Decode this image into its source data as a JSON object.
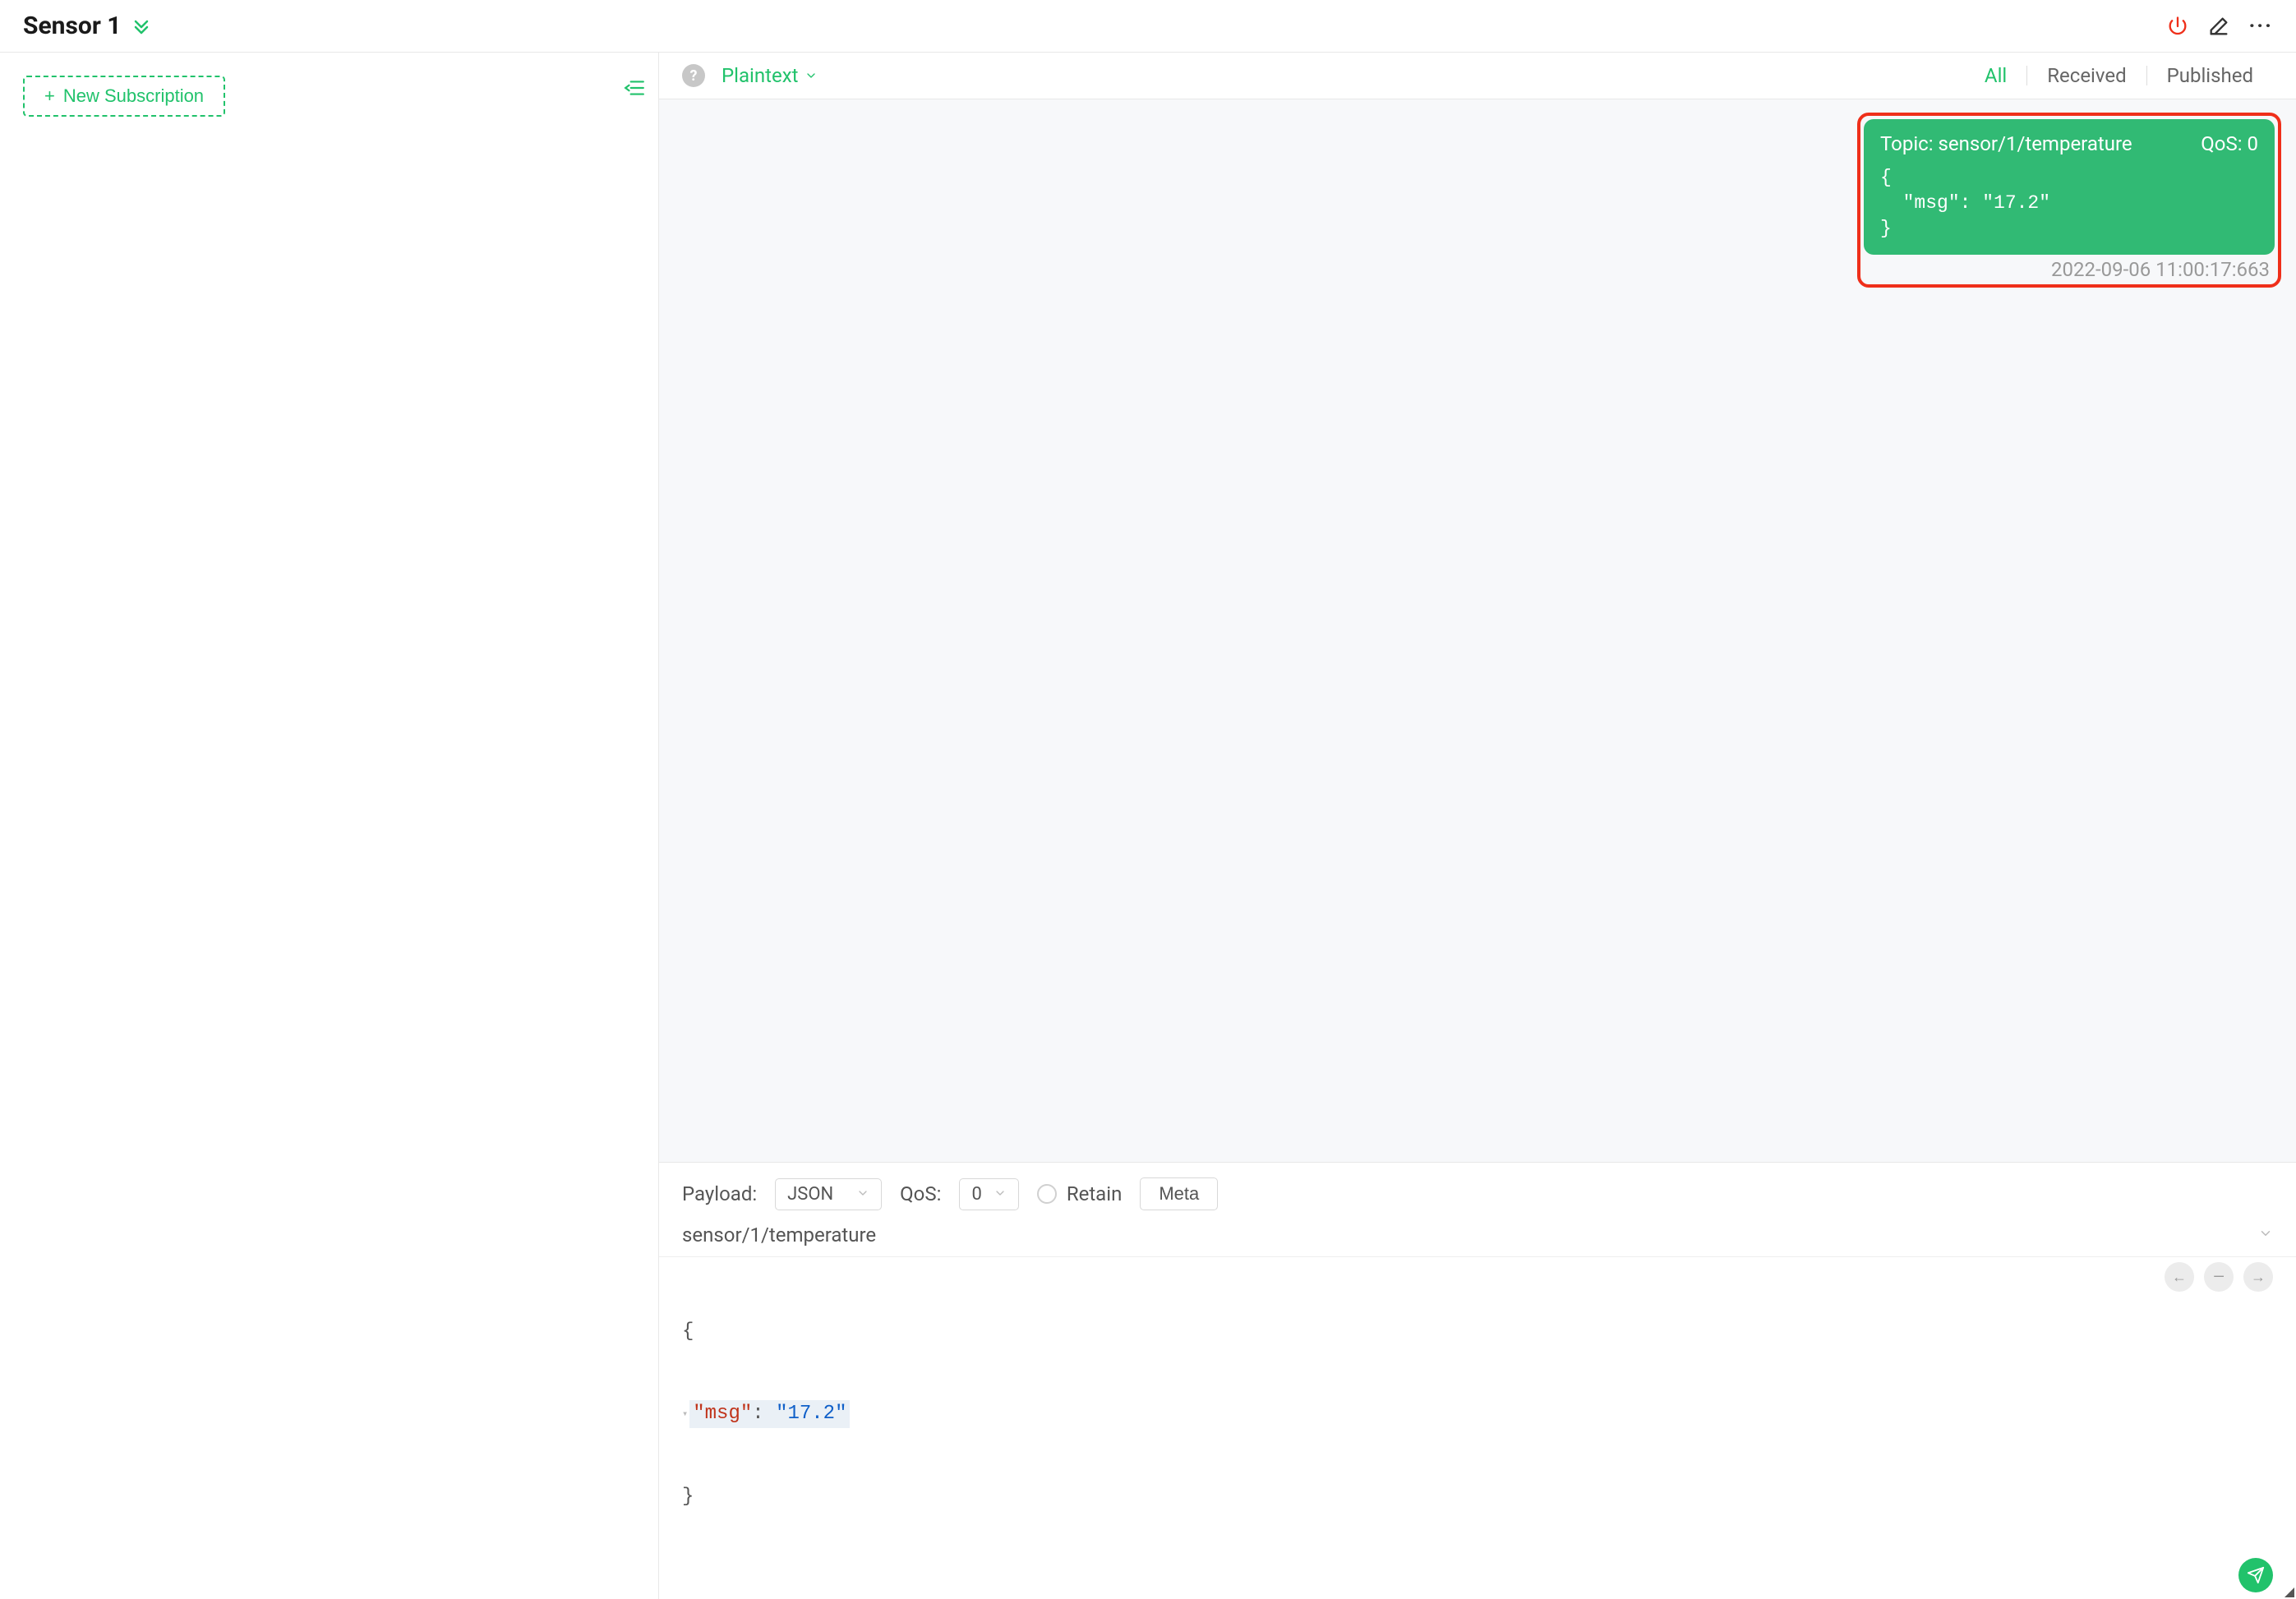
{
  "header": {
    "title": "Sensor 1"
  },
  "sidebar": {
    "new_subscription_label": "New Subscription"
  },
  "filter": {
    "help": "?",
    "format": "Plaintext",
    "tabs": {
      "all": "All",
      "received": "Received",
      "published": "Published"
    }
  },
  "message": {
    "topic_label": "Topic: sensor/1/temperature",
    "qos_label": "QoS: 0",
    "body": "{\n  \"msg\": \"17.2\"\n}",
    "timestamp": "2022-09-06 11:00:17:663"
  },
  "publish": {
    "payload_label": "Payload:",
    "payload_format": "JSON",
    "qos_label": "QoS:",
    "qos_value": "0",
    "retain_label": "Retain",
    "meta_label": "Meta",
    "topic": "sensor/1/temperature",
    "editor": {
      "open": "{",
      "key": "\"msg\"",
      "colon": ": ",
      "val": "\"17.2\"",
      "close": "}"
    }
  }
}
